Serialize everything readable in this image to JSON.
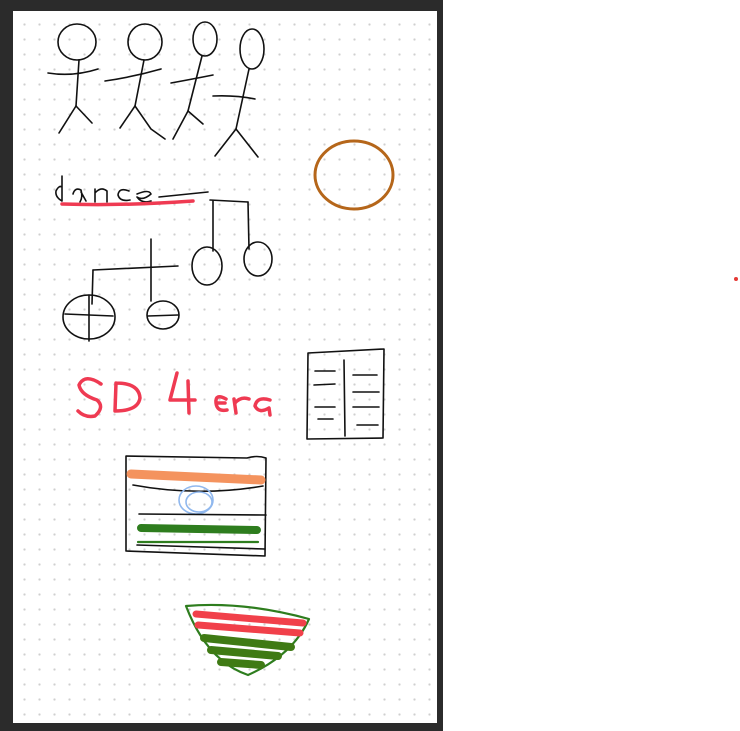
{
  "canvas": {
    "page_style": "dot-grid",
    "sketches": [
      {
        "name": "stick-figures",
        "color": "#111111"
      },
      {
        "name": "dance-word",
        "text": "dance",
        "color": "#111111",
        "underline_color": "#ef3a52"
      },
      {
        "name": "music-notes",
        "color": "#111111"
      },
      {
        "name": "cookie",
        "color": "#b5661a"
      },
      {
        "name": "sd-4-ever-text",
        "text": "SD 4 eva",
        "color": "#ef3a52"
      },
      {
        "name": "notebook",
        "color": "#111111"
      },
      {
        "name": "india-flag",
        "colors": [
          "#f4935e",
          "#90b8ee",
          "#2e7d1e"
        ]
      },
      {
        "name": "watermelon-bowl",
        "colors": [
          "#f1404a",
          "#3f7a14"
        ]
      }
    ]
  },
  "pointer": {
    "type": "laser-dot",
    "color": "#e53935"
  }
}
